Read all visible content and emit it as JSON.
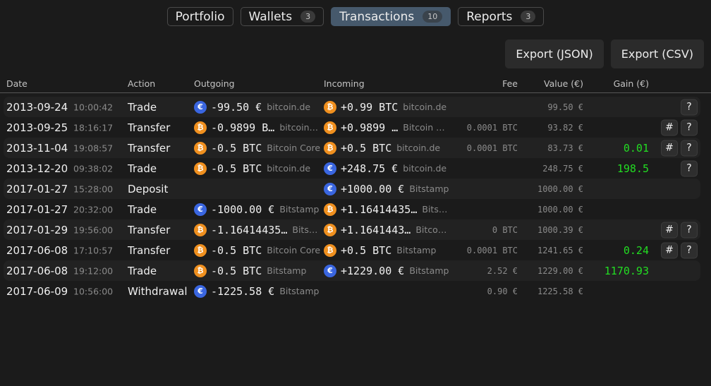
{
  "tabs": [
    {
      "label": "Portfolio",
      "badge": null,
      "active": false
    },
    {
      "label": "Wallets",
      "badge": "3",
      "active": false
    },
    {
      "label": "Transactions",
      "badge": "10",
      "active": true
    },
    {
      "label": "Reports",
      "badge": "3",
      "active": false
    }
  ],
  "toolbar": {
    "export_json": "Export (JSON)",
    "export_csv": "Export (CSV)"
  },
  "columns": {
    "date": "Date",
    "action": "Action",
    "outgoing": "Outgoing",
    "incoming": "Incoming",
    "fee": "Fee",
    "value": "Value (€)",
    "gain": "Gain (€)"
  },
  "icons": {
    "eur": "€",
    "btc": "₿",
    "hash": "#",
    "help": "?"
  },
  "colors": {
    "eur_coin": "#3a66e0",
    "btc_coin": "#f0901f",
    "gain_positive": "#22dd22",
    "active_tab": "#46596c"
  },
  "rows": [
    {
      "date": "2013-09-24",
      "time": "10:00:42",
      "action": "Trade",
      "out": {
        "coin": "eur",
        "amount": "-99.50 €",
        "wallet": "bitcoin.de"
      },
      "in": {
        "coin": "btc",
        "amount": "+0.99 BTC",
        "wallet": "bitcoin.de"
      },
      "fee": "",
      "value": "99.50 €",
      "gain": "",
      "hash": false,
      "help": true
    },
    {
      "date": "2013-09-25",
      "time": "18:16:17",
      "action": "Transfer",
      "out": {
        "coin": "btc",
        "amount": "-0.9899 B…",
        "wallet": "bitcoin…"
      },
      "in": {
        "coin": "btc",
        "amount": "+0.9899 …",
        "wallet": "Bitcoin …"
      },
      "fee": "0.0001 BTC",
      "value": "93.82 €",
      "gain": "",
      "hash": true,
      "help": true
    },
    {
      "date": "2013-11-04",
      "time": "19:08:57",
      "action": "Transfer",
      "out": {
        "coin": "btc",
        "amount": "-0.5 BTC",
        "wallet": "Bitcoin Core"
      },
      "in": {
        "coin": "btc",
        "amount": "+0.5 BTC",
        "wallet": "bitcoin.de"
      },
      "fee": "0.0001 BTC",
      "value": "83.73 €",
      "gain": "0.01",
      "hash": true,
      "help": true
    },
    {
      "date": "2013-12-20",
      "time": "09:38:02",
      "action": "Trade",
      "out": {
        "coin": "btc",
        "amount": "-0.5 BTC",
        "wallet": "bitcoin.de"
      },
      "in": {
        "coin": "eur",
        "amount": "+248.75 €",
        "wallet": "bitcoin.de"
      },
      "fee": "",
      "value": "248.75 €",
      "gain": "198.5",
      "hash": false,
      "help": true
    },
    {
      "date": "2017-01-27",
      "time": "15:28:00",
      "action": "Deposit",
      "out": null,
      "in": {
        "coin": "eur",
        "amount": "+1000.00 €",
        "wallet": "Bitstamp"
      },
      "fee": "",
      "value": "1000.00 €",
      "gain": "",
      "hash": false,
      "help": false
    },
    {
      "date": "2017-01-27",
      "time": "20:32:00",
      "action": "Trade",
      "out": {
        "coin": "eur",
        "amount": "-1000.00 €",
        "wallet": "Bitstamp"
      },
      "in": {
        "coin": "btc",
        "amount": "+1.16414435…",
        "wallet": "Bits…"
      },
      "fee": "",
      "value": "1000.00 €",
      "gain": "",
      "hash": false,
      "help": false
    },
    {
      "date": "2017-01-29",
      "time": "19:56:00",
      "action": "Transfer",
      "out": {
        "coin": "btc",
        "amount": "-1.16414435…",
        "wallet": "Bits…"
      },
      "in": {
        "coin": "btc",
        "amount": "+1.1641443…",
        "wallet": "Bitco…"
      },
      "fee": "0 BTC",
      "value": "1000.39 €",
      "gain": "",
      "hash": true,
      "help": true
    },
    {
      "date": "2017-06-08",
      "time": "17:10:57",
      "action": "Transfer",
      "out": {
        "coin": "btc",
        "amount": "-0.5 BTC",
        "wallet": "Bitcoin Core"
      },
      "in": {
        "coin": "btc",
        "amount": "+0.5 BTC",
        "wallet": "Bitstamp"
      },
      "fee": "0.0001 BTC",
      "value": "1241.65 €",
      "gain": "0.24",
      "hash": true,
      "help": true
    },
    {
      "date": "2017-06-08",
      "time": "19:12:00",
      "action": "Trade",
      "out": {
        "coin": "btc",
        "amount": "-0.5 BTC",
        "wallet": "Bitstamp"
      },
      "in": {
        "coin": "eur",
        "amount": "+1229.00 €",
        "wallet": "Bitstamp"
      },
      "fee": "2.52 €",
      "value": "1229.00 €",
      "gain": "1170.93",
      "hash": false,
      "help": false
    },
    {
      "date": "2017-06-09",
      "time": "10:56:00",
      "action": "Withdrawal",
      "out": {
        "coin": "eur",
        "amount": "-1225.58 €",
        "wallet": "Bitstamp"
      },
      "in": null,
      "fee": "0.90 €",
      "value": "1225.58 €",
      "gain": "",
      "hash": false,
      "help": false
    }
  ]
}
